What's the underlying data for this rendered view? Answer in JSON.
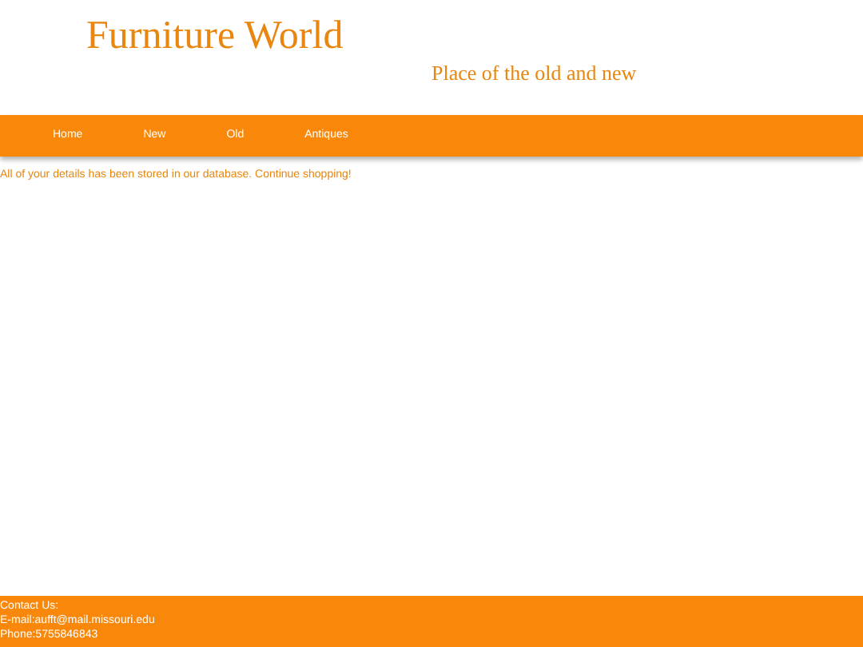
{
  "header": {
    "title": "Furniture World",
    "tagline": "Place of the old and new"
  },
  "nav": [
    {
      "label": "Home"
    },
    {
      "label": "New"
    },
    {
      "label": "Old"
    },
    {
      "label": "Antiques"
    }
  ],
  "message": "All of your details has been stored in our database. Continue shopping!",
  "footer": [
    "Contact Us:",
    "E-mail:aufft@mail.missouri.edu",
    "Phone:5755846843"
  ]
}
